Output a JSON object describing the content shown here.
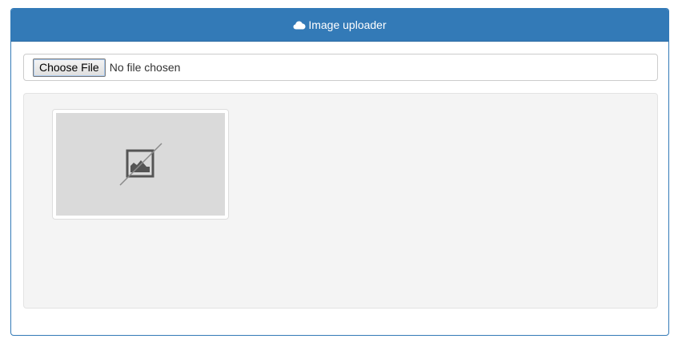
{
  "panel": {
    "title": "Image uploader",
    "title_icon": "cloud-icon",
    "accent_color": "#337ab7"
  },
  "uploader": {
    "button_label": "Choose File",
    "status_text": "No file chosen"
  },
  "preview": {
    "placeholder_icon": "broken-image-icon",
    "background_color": "#f4f4f4"
  }
}
